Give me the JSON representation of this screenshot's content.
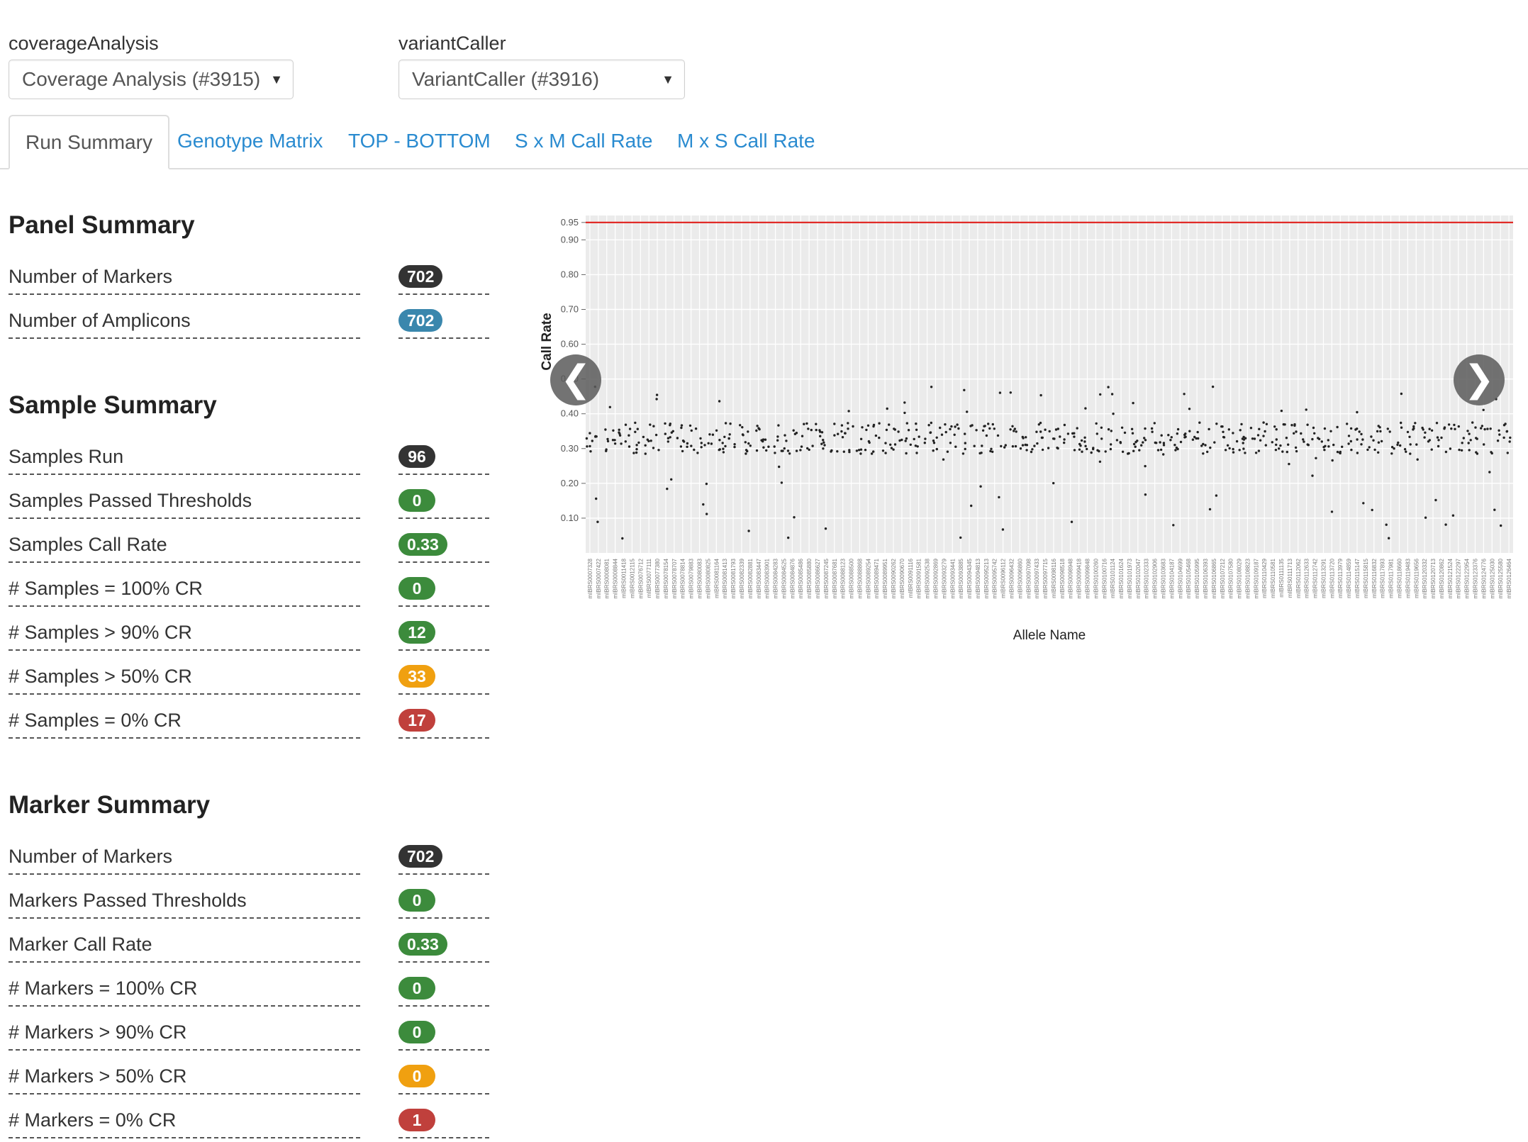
{
  "selectors": {
    "coverage": {
      "label": "coverageAnalysis",
      "value": "Coverage Analysis (#3915)"
    },
    "variant": {
      "label": "variantCaller",
      "value": "VariantCaller (#3916)"
    }
  },
  "tabs": [
    {
      "label": "Run Summary",
      "active": true
    },
    {
      "label": "Genotype Matrix"
    },
    {
      "label": "TOP - BOTTOM"
    },
    {
      "label": "S x M Call Rate"
    },
    {
      "label": "M x S Call Rate"
    }
  ],
  "panel_summary": {
    "title": "Panel Summary",
    "rows": [
      {
        "label": "Number of Markers",
        "value": "702",
        "color": "#333333"
      },
      {
        "label": "Number of Amplicons",
        "value": "702",
        "color": "#3a87ad"
      }
    ]
  },
  "sample_summary": {
    "title": "Sample Summary",
    "rows": [
      {
        "label": "Samples Run",
        "value": "96",
        "color": "#333333"
      },
      {
        "label": "Samples Passed Thresholds",
        "value": "0",
        "color": "#3c8b3c"
      },
      {
        "label": "Samples Call Rate",
        "value": "0.33",
        "color": "#3c8b3c"
      },
      {
        "label": "# Samples = 100% CR",
        "value": "0",
        "color": "#3c8b3c"
      },
      {
        "label": "# Samples > 90% CR",
        "value": "12",
        "color": "#3c8b3c"
      },
      {
        "label": "# Samples > 50% CR",
        "value": "33",
        "color": "#f0a010"
      },
      {
        "label": "# Samples = 0% CR",
        "value": "17",
        "color": "#c0403c"
      }
    ]
  },
  "marker_summary": {
    "title": "Marker Summary",
    "rows": [
      {
        "label": "Number of Markers",
        "value": "702",
        "color": "#333333"
      },
      {
        "label": "Markers Passed Thresholds",
        "value": "0",
        "color": "#3c8b3c"
      },
      {
        "label": "Marker Call Rate",
        "value": "0.33",
        "color": "#3c8b3c"
      },
      {
        "label": "# Markers = 100% CR",
        "value": "0",
        "color": "#3c8b3c"
      },
      {
        "label": "# Markers > 90% CR",
        "value": "0",
        "color": "#3c8b3c"
      },
      {
        "label": "# Markers > 50% CR",
        "value": "0",
        "color": "#f0a010"
      },
      {
        "label": "# Markers = 0% CR",
        "value": "1",
        "color": "#c0403c"
      }
    ]
  },
  "carousel": {
    "prev_icon": "❮",
    "next_icon": "❯"
  },
  "chart_data": {
    "type": "scatter",
    "xlabel": "Allele Name",
    "ylabel": "Call Rate",
    "ylim": [
      0,
      0.97
    ],
    "yticks": [
      "0.10",
      "0.20",
      "0.30",
      "0.40",
      "0.50",
      "0.60",
      "0.70",
      "0.80",
      "0.90",
      "0.95"
    ],
    "threshold": {
      "value": 0.95,
      "color": "#e0201c"
    },
    "background": "#ebebeb",
    "grid": true,
    "x_categories": [
      "mIBRS0007328",
      "mIBRS0007422",
      "mIBRS0008081",
      "mIBRS0008844",
      "mIBRS0011418",
      "mIBRS0012115",
      "mIBRS0076712",
      "mIBRS0077111",
      "mIBRS0077380",
      "mIBRS0078154",
      "mIBRS0078707",
      "mIBRS0078814",
      "mIBRS0079883",
      "mIBRS0080083",
      "mIBRS0080825",
      "mIBRS0081164",
      "mIBRS0081413",
      "mIBRS0081793",
      "mIBRS0082339",
      "mIBRS0082881",
      "mIBRS0083447",
      "mIBRS0083901",
      "mIBRS0084283",
      "mIBRS0084525",
      "mIBRS0084876",
      "mIBRS0085486",
      "mIBRS0085880",
      "mIBRS0086627",
      "mIBRS0087245",
      "mIBRS0087681",
      "mIBRS0088123",
      "mIBRS0088500",
      "mIBRS0088868",
      "mIBRS0089254",
      "mIBRS0089471",
      "mIBRS0089951",
      "mIBRS0090262",
      "mIBRS0090670",
      "mIBRS0091116",
      "mIBRS0091581",
      "mIBRS0092538",
      "mIBRS0092869",
      "mIBRS0093279",
      "mIBRS0093441",
      "mIBRS0093885",
      "mIBRS0094345",
      "mIBRS0094813",
      "mIBRS0095213",
      "mIBRS0095742",
      "mIBRS0096112",
      "mIBRS0096432",
      "mIBRS0096860",
      "mIBRS0097098",
      "mIBRS0097433",
      "mIBRS0097715",
      "mIBRS0098116",
      "mIBRS0098518",
      "mIBRS0098948",
      "mIBRS0099418",
      "mIBRS0099848",
      "mIBRS0100260",
      "mIBRS0100716",
      "mIBRS0101124",
      "mIBRS0101624",
      "mIBRS0101973",
      "mIBRS0102047",
      "mIBRS0102333",
      "mIBRS0102906",
      "mIBRS0103683",
      "mIBRS0104187",
      "mIBRS0104699",
      "mIBRS0105468",
      "mIBRS0105995",
      "mIBRS0106393",
      "mIBRS0106865",
      "mIBRS0107212",
      "mIBRS0107580",
      "mIBRS0108029",
      "mIBRS0108823",
      "mIBRS0109187",
      "mIBRS0110429",
      "mIBRS0110581",
      "mIBRS0111135",
      "mIBRS0111713",
      "mIBRS0112062",
      "mIBRS0112633",
      "mIBRS0112742",
      "mIBRS0113291",
      "mIBRS0113720",
      "mIBRS0113979",
      "mIBRS0114859",
      "mIBRS0115147",
      "mIBRS0115815",
      "mIBRS0116832",
      "mIBRS0117893",
      "mIBRS0117981",
      "mIBRS0118660",
      "mIBRS0119483",
      "mIBRS0119656",
      "mIBRS0120332",
      "mIBRS0120713",
      "mIBRS0120862",
      "mIBRS0121524",
      "mIBRS0122297",
      "mIBRS0122954",
      "mIBRS0123376",
      "mIBRS0124776",
      "mIBRS0125030",
      "mIBRS0125580",
      "mIBRS0126464"
    ]
  }
}
